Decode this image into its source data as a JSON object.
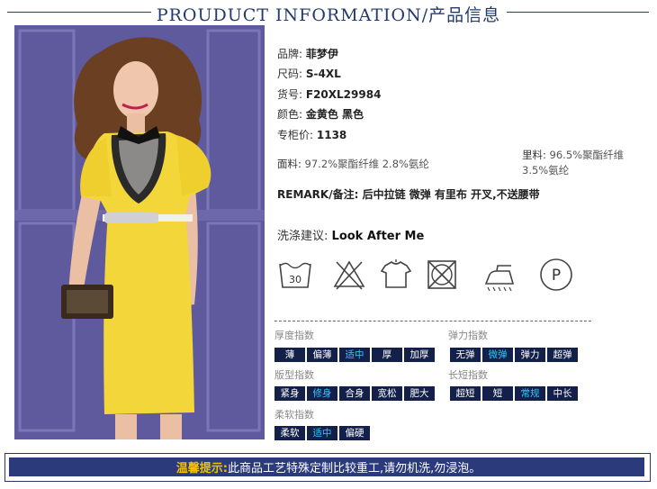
{
  "header": {
    "title": "PROUDUCT INFORMATION/产品信息"
  },
  "specs": {
    "brand": {
      "label": "品牌:",
      "value": "菲梦伊"
    },
    "size": {
      "label": "尺码:",
      "value": "S-4XL"
    },
    "item_no": {
      "label": "货号:",
      "value": "F20XL29984"
    },
    "color": {
      "label": "颜色:",
      "value": "金黄色  黑色"
    },
    "price": {
      "label": "专柜价:",
      "value": "1138"
    },
    "fabric": {
      "label": "面料:",
      "value": "97.2%聚酯纤维 2.8%氨纶"
    },
    "lining": {
      "label": "里料:",
      "value_line1": "96.5%聚酯纤维",
      "value_line2": "3.5%氨纶"
    },
    "remark": "REMARK/备注: 后中拉链 微弹 有里布 开叉,不送腰带",
    "wash": {
      "label": "洗涤建议:",
      "value": "Look After Me"
    }
  },
  "care_icons": [
    {
      "name": "wash-30-icon",
      "text": "30"
    },
    {
      "name": "no-bleach-icon"
    },
    {
      "name": "hang-dry-icon"
    },
    {
      "name": "no-tumble-dry-icon"
    },
    {
      "name": "iron-icon"
    },
    {
      "name": "dry-clean-p-icon",
      "text": "P"
    }
  ],
  "scales": {
    "thickness": {
      "title": "厚度指数",
      "options": [
        "薄",
        "偏薄",
        "适中",
        "厚",
        "加厚"
      ],
      "selected": 2
    },
    "elasticity": {
      "title": "弹力指数",
      "options": [
        "无弹",
        "微弹",
        "弹力",
        "超弹"
      ],
      "selected": 1
    },
    "fit": {
      "title": "版型指数",
      "options": [
        "紧身",
        "修身",
        "合身",
        "宽松",
        "肥大"
      ],
      "selected": 1
    },
    "length": {
      "title": "长短指数",
      "options": [
        "超短",
        "短",
        "常规",
        "中长"
      ],
      "selected": 2
    },
    "softness": {
      "title": "柔软指数",
      "options": [
        "柔软",
        "适中",
        "偏硬"
      ],
      "selected": 1
    }
  },
  "footer": {
    "tip_label": "温馨提示:",
    "text": "此商品工艺特殊定制比较重工,请勿机洗,勿浸泡。"
  },
  "colors": {
    "navy": "#13204a",
    "accent_cyan": "#2ec8ff",
    "tip_yellow": "#f2c200",
    "dress_yellow": "#f2d63a"
  }
}
